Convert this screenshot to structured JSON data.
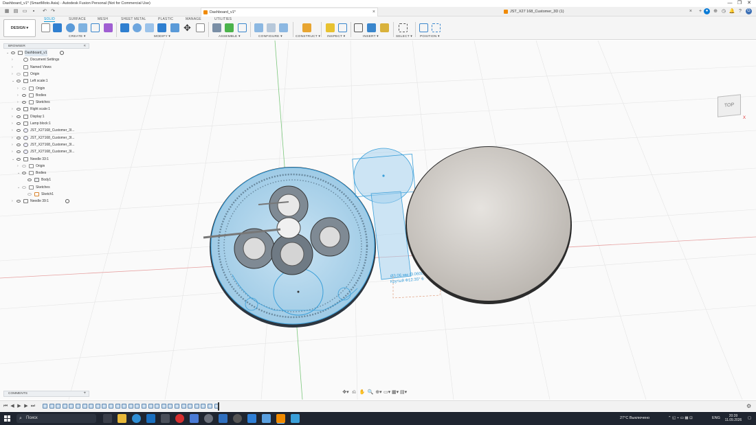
{
  "window": {
    "title": "Dashboard_v1* (SmartMoto.Asia) - Autodesk Fusion Personal (Not for Commercial Use)",
    "min_label": "—",
    "max_label": "❐",
    "close_label": "✕"
  },
  "tabs": [
    {
      "label": "Dashboard_v1*",
      "active": true
    },
    {
      "label": "JST_X27 168_Customer_3D (1)",
      "active": false
    }
  ],
  "toolbar": {
    "workspace": "DESIGN ▾",
    "workspace_tabs": [
      "SOLID",
      "SURFACE",
      "MESH",
      "SHEET METAL",
      "PLASTIC",
      "MANAGE",
      "UTILITIES"
    ],
    "groups": [
      "CREATE ▾",
      "MODIFY ▾",
      "ASSEMBLE ▾",
      "CONFIGURE ▾",
      "CONSTRUCT ▾",
      "INSPECT ▾",
      "INSERT ▾",
      "SELECT ▾",
      "POSITION ▾"
    ]
  },
  "browser": {
    "title": "BROWSER",
    "collapse": "«",
    "items": [
      {
        "label": "Dashboard_v1",
        "indent": 0,
        "caret": "⌄",
        "icon": "document",
        "eye": true,
        "radio": true,
        "selected": true
      },
      {
        "label": "Document Settings",
        "indent": 1,
        "caret": "›",
        "icon": "gear",
        "eye": false
      },
      {
        "label": "Named Views",
        "indent": 1,
        "caret": "›",
        "icon": "folder",
        "eye": false
      },
      {
        "label": "Origin",
        "indent": 1,
        "caret": "›",
        "icon": "folder",
        "eye": true,
        "eye_off": true
      },
      {
        "label": "Left scale:1",
        "indent": 1,
        "caret": "⌄",
        "icon": "component",
        "eye": true
      },
      {
        "label": "Origin",
        "indent": 2,
        "caret": "›",
        "icon": "folder",
        "eye": true,
        "eye_off": true
      },
      {
        "label": "Bodies",
        "indent": 2,
        "caret": "›",
        "icon": "folder",
        "eye": true
      },
      {
        "label": "Sketches",
        "indent": 2,
        "caret": "›",
        "icon": "folder",
        "eye": true
      },
      {
        "label": "Right scale:1",
        "indent": 1,
        "caret": "›",
        "icon": "component",
        "eye": true
      },
      {
        "label": "Display:1",
        "indent": 1,
        "caret": "›",
        "icon": "component",
        "eye": true
      },
      {
        "label": "Lamp block:1",
        "indent": 1,
        "caret": "›",
        "icon": "component",
        "eye": true
      },
      {
        "label": "JST_X27168_Customer_3I...",
        "indent": 1,
        "caret": "›",
        "icon": "link",
        "eye": true
      },
      {
        "label": "JST_X27168_Customer_3I...",
        "indent": 1,
        "caret": "›",
        "icon": "link",
        "eye": true
      },
      {
        "label": "JST_X27168_Customer_3I...",
        "indent": 1,
        "caret": "›",
        "icon": "link",
        "eye": true
      },
      {
        "label": "JST_X27168_Customer_3I...",
        "indent": 1,
        "caret": "›",
        "icon": "link",
        "eye": true
      },
      {
        "label": "Needle 33:1",
        "indent": 1,
        "caret": "⌄",
        "icon": "component",
        "eye": true
      },
      {
        "label": "Origin",
        "indent": 2,
        "caret": "›",
        "icon": "folder",
        "eye": true,
        "eye_off": true
      },
      {
        "label": "Bodies",
        "indent": 2,
        "caret": "⌄",
        "icon": "folder",
        "eye": true
      },
      {
        "label": "Body1",
        "indent": 3,
        "caret": "",
        "icon": "body",
        "eye": true
      },
      {
        "label": "Sketches",
        "indent": 2,
        "caret": "⌄",
        "icon": "folder",
        "eye": true,
        "eye_off": true
      },
      {
        "label": "Sketch1",
        "indent": 3,
        "caret": "",
        "icon": "sketch",
        "eye": true,
        "eye_off": true
      },
      {
        "label": "Needle 39:1",
        "indent": 1,
        "caret": "›",
        "icon": "component",
        "eye": true,
        "radio": true
      }
    ]
  },
  "viewcube": {
    "face": "TOP",
    "axis": "X"
  },
  "canvas_annotation": {
    "line1": "Ø3.06 мм (3.0600) Отверстие/3005017066679066 Мм",
    "line2": "Крутый Ф12.35° 6"
  },
  "comments": {
    "title": "COMMENTS",
    "add": "+"
  },
  "navbar": [
    "✥▾",
    "⎌",
    "✋",
    "🔍",
    "⊕▾",
    "▭▾",
    "▦▾",
    "▤▾"
  ],
  "timeline": {
    "controls": [
      "⏮",
      "◀",
      "▶",
      "▶",
      "⏭"
    ],
    "item_count": 27,
    "settings": "⚙"
  },
  "taskbar": {
    "search_placeholder": "Поиск",
    "weather": "27°C Выключено",
    "lang": "ENG",
    "time": "20:39",
    "date": "11.09.2026"
  },
  "colors": {
    "accent": "#0696d7",
    "sketch_blue": "#3a9fd9",
    "canvas_bg": "#fafafa",
    "taskbar": "#1f2530"
  }
}
